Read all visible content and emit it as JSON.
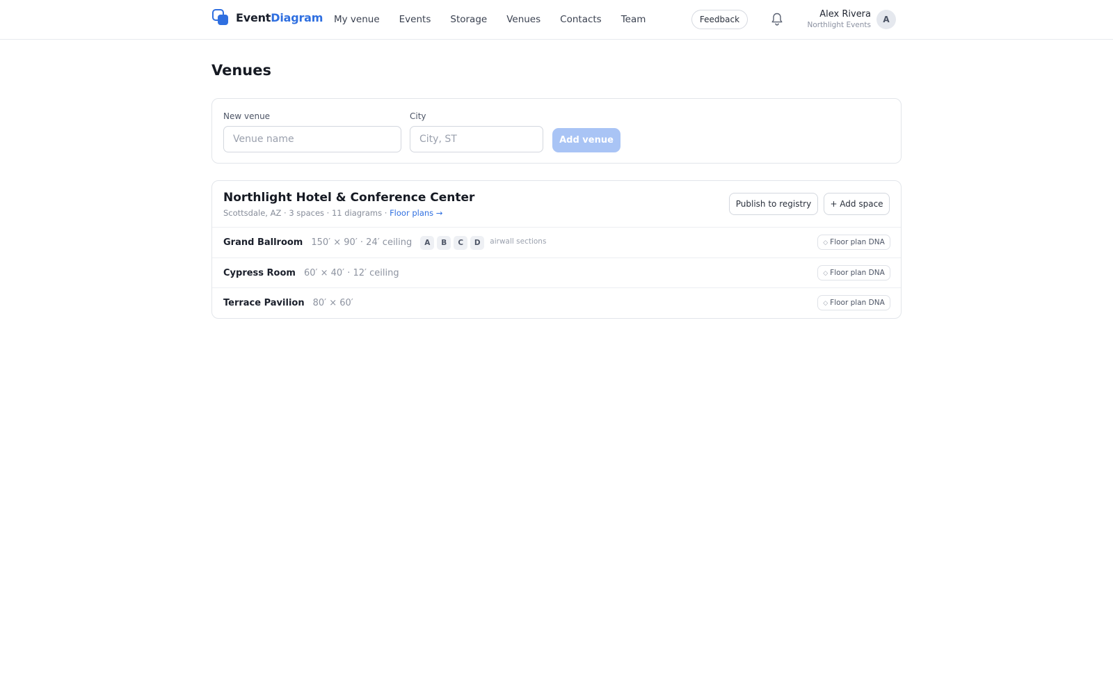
{
  "header": {
    "logo_part1": "Event",
    "logo_part2": "Diagram",
    "nav": [
      "My venue",
      "Events",
      "Storage",
      "Venues",
      "Contacts",
      "Team"
    ],
    "feedback_label": "Feedback",
    "bell_icon": "bell-icon",
    "user_name": "Alex Rivera",
    "user_org": "Northlight Events",
    "avatar_initial": "A"
  },
  "page": {
    "title": "Venues"
  },
  "new_venue": {
    "name_label": "New venue",
    "name_placeholder": "Venue name",
    "name_value": "",
    "city_label": "City",
    "city_placeholder": "City, ST",
    "city_value": "",
    "add_label": "Add venue"
  },
  "venue": {
    "name": "Northlight Hotel & Conference Center",
    "meta_city": "Scottsdale, AZ",
    "meta_spaces": "3 spaces",
    "meta_diagrams": "11 diagrams",
    "meta_link": "Floor plans →",
    "separator": "·",
    "publish_label": "Publish to registry",
    "add_space_label": "+ Add space",
    "spaces": [
      {
        "name": "Grand Ballroom",
        "dims": "150′ × 90′ · 24′ ceiling",
        "airwalls": [
          "A",
          "B",
          "C",
          "D"
        ],
        "airwall_note": "airwall sections",
        "dna_label": "Floor plan DNA"
      },
      {
        "name": "Cypress Room",
        "dims": "60′ × 40′ · 12′ ceiling",
        "dna_label": "Floor plan DNA"
      },
      {
        "name": "Terrace Pavilion",
        "dims": "80′ × 60′",
        "dna_label": "Floor plan DNA"
      }
    ],
    "dna_icon": "◇"
  },
  "colors": {
    "accent": "#2f6fe0",
    "accent_disabled": "#a9c4f5"
  }
}
